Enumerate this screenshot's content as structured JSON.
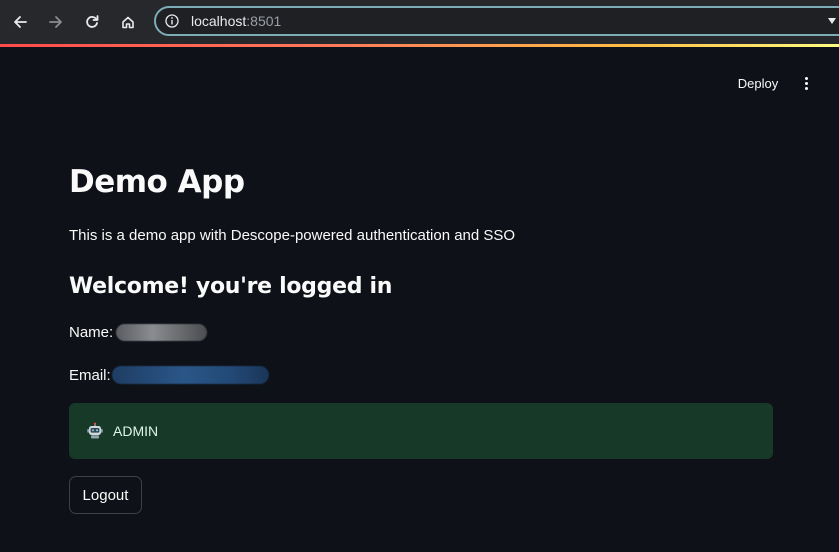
{
  "browser": {
    "url_host": "localhost",
    "url_port": ":8501",
    "icons": {
      "back": "arrow-left-icon",
      "forward": "arrow-right-icon",
      "reload": "reload-icon",
      "home": "home-icon",
      "info": "info-icon",
      "dropdown": "chevron-down-icon"
    }
  },
  "header": {
    "deploy_label": "Deploy",
    "menu_icon": "vertical-dots-icon"
  },
  "main": {
    "title": "Demo App",
    "description": "This is a demo app with Descope-powered authentication and SSO",
    "welcome": "Welcome! you're logged in",
    "name_label": "Name:",
    "email_label": "Email:",
    "role": {
      "icon": "robot-icon",
      "text": "ADMIN"
    },
    "logout_label": "Logout"
  },
  "colors": {
    "background": "#0e1117",
    "text": "#fafafa",
    "role_box_bg": "#173928",
    "address_bar_border": "#7cacb6",
    "decoration_start": "#ff4b4b",
    "decoration_end": "#fffd80"
  }
}
